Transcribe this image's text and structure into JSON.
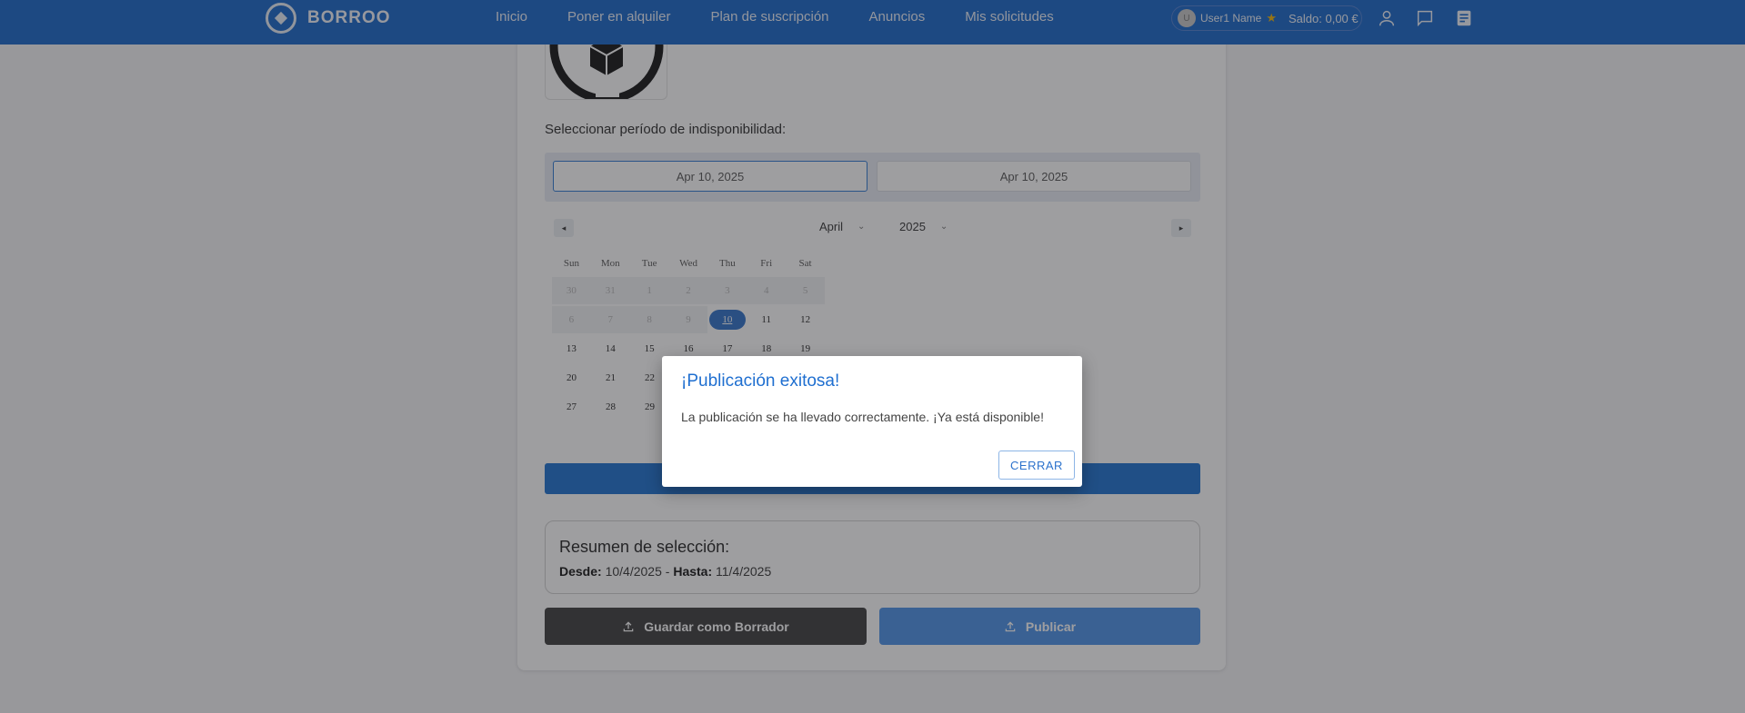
{
  "nav": {
    "brand": "BORROO",
    "links": [
      "Inicio",
      "Poner en alquiler",
      "Plan de suscripción",
      "Anuncios",
      "Mis solicitudes"
    ],
    "user_initial": "U",
    "user_name": "User1 Name",
    "star": "★",
    "balance": "Saldo: 0,00 €",
    "icons": [
      "user-icon",
      "chat-icon",
      "document-icon"
    ]
  },
  "form": {
    "unavailable_label": "Seleccionar período de indisponibilidad:",
    "start_date": "Apr 10, 2025",
    "end_date": "Apr 10, 2025"
  },
  "calendar": {
    "month": "April",
    "year": "2025",
    "prev": "◂",
    "next": "▸",
    "weekdays": [
      "Sun",
      "Mon",
      "Tue",
      "Wed",
      "Thu",
      "Fri",
      "Sat"
    ],
    "weeks": [
      [
        "30",
        "31",
        "1",
        "2",
        "3",
        "4",
        "5"
      ],
      [
        "6",
        "7",
        "8",
        "9",
        "10",
        "11",
        "12"
      ],
      [
        "13",
        "14",
        "15",
        "16",
        "17",
        "18",
        "19"
      ],
      [
        "20",
        "21",
        "22",
        "",
        "",
        "",
        ""
      ],
      [
        "27",
        "28",
        "29",
        "",
        "",
        "",
        ""
      ]
    ],
    "selected": "10"
  },
  "summary": {
    "title": "Resumen de selección:",
    "from_label": "Desde:",
    "from_value": "10/4/2025",
    "separator": "-",
    "to_label": "Hasta:",
    "to_value": "11/4/2025"
  },
  "actions": {
    "draft_label": "Guardar como Borrador",
    "publish_label": "Publicar"
  },
  "dialog": {
    "title": "¡Publicación exitosa!",
    "message": "La publicación se ha llevado correctamente. ¡Ya está disponible!",
    "close_label": "CERRAR"
  },
  "colors": {
    "navbar": "#1565c8",
    "primary": "#1a6fd0",
    "publish": "#4a90e8",
    "draft": "#3b3b3b",
    "dialog_title": "#1f6fd0"
  }
}
